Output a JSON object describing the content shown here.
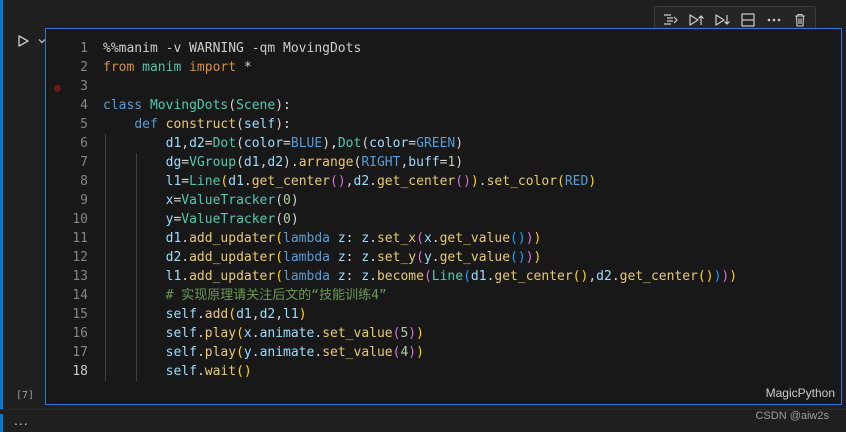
{
  "cell": {
    "execution_count": "[7]",
    "language": "MagicPython",
    "active_line": 18,
    "breakpoint_line": 3,
    "lines": [
      {
        "n": "1",
        "tokens": [
          [
            "mg",
            "%%manim -v WARNING -qm MovingDots"
          ]
        ]
      },
      {
        "n": "2",
        "tokens": [
          [
            "kw",
            "from "
          ],
          [
            "kc",
            "manim "
          ],
          [
            "kw",
            "import "
          ],
          [
            "",
            ""
          ],
          [
            "",
            "*"
          ]
        ]
      },
      {
        "n": "3",
        "tokens": []
      },
      {
        "n": "4",
        "tokens": [
          [
            "kb",
            "class "
          ],
          [
            "cl",
            "MovingDots"
          ],
          [
            "",
            "("
          ],
          [
            "cl",
            "Scene"
          ],
          [
            "",
            "):"
          ]
        ]
      },
      {
        "n": "5",
        "tokens": [
          [
            "",
            "    "
          ],
          [
            "kb",
            "def "
          ],
          [
            "fn",
            "construct"
          ],
          [
            "",
            "("
          ],
          [
            "va",
            "self"
          ],
          [
            "",
            "):"
          ]
        ]
      },
      {
        "n": "6",
        "tokens": [
          [
            "",
            "        "
          ],
          [
            "va",
            "d1"
          ],
          [
            "",
            ","
          ],
          [
            "va",
            "d2"
          ],
          [
            "",
            "="
          ],
          [
            "cl",
            "Dot"
          ],
          [
            "",
            "("
          ],
          [
            "va",
            "color"
          ],
          [
            "",
            "="
          ],
          [
            "kb",
            "BLUE"
          ],
          [
            "",
            "),"
          ],
          [
            "cl",
            "Dot"
          ],
          [
            "",
            "("
          ],
          [
            "va",
            "color"
          ],
          [
            "",
            "="
          ],
          [
            "kb",
            "GREEN"
          ],
          [
            "",
            ")"
          ]
        ]
      },
      {
        "n": "7",
        "tokens": [
          [
            "",
            "        "
          ],
          [
            "va",
            "dg"
          ],
          [
            "",
            "="
          ],
          [
            "cl",
            "VGroup"
          ],
          [
            "",
            "("
          ],
          [
            "va",
            "d1"
          ],
          [
            "",
            ","
          ],
          [
            "va",
            "d2"
          ],
          [
            "",
            ")."
          ],
          [
            "fn",
            "arrange"
          ],
          [
            "",
            "("
          ],
          [
            "kb",
            "RIGHT"
          ],
          [
            "",
            ","
          ],
          [
            "va",
            "buff"
          ],
          [
            "",
            "="
          ],
          [
            "nu",
            "1"
          ],
          [
            "",
            ")"
          ]
        ]
      },
      {
        "n": "8",
        "tokens": [
          [
            "",
            "        "
          ],
          [
            "va",
            "l1"
          ],
          [
            "",
            "="
          ],
          [
            "cl",
            "Line"
          ],
          [
            "p1",
            "("
          ],
          [
            "va",
            "d1"
          ],
          [
            "",
            "."
          ],
          [
            "fn",
            "get_center"
          ],
          [
            "p2",
            "()"
          ],
          [
            "",
            ","
          ],
          [
            "va",
            "d2"
          ],
          [
            "",
            "."
          ],
          [
            "fn",
            "get_center"
          ],
          [
            "p2",
            "()"
          ],
          [
            "p1",
            ")"
          ],
          [
            "",
            "."
          ],
          [
            "fn",
            "set_color"
          ],
          [
            "p1",
            "("
          ],
          [
            "kb",
            "RED"
          ],
          [
            "p1",
            ")"
          ]
        ]
      },
      {
        "n": "9",
        "tokens": [
          [
            "",
            "        "
          ],
          [
            "va",
            "x"
          ],
          [
            "",
            "="
          ],
          [
            "cl",
            "ValueTracker"
          ],
          [
            "",
            "("
          ],
          [
            "nu",
            "0"
          ],
          [
            "",
            ")"
          ]
        ]
      },
      {
        "n": "10",
        "tokens": [
          [
            "",
            "        "
          ],
          [
            "va",
            "y"
          ],
          [
            "",
            "="
          ],
          [
            "cl",
            "ValueTracker"
          ],
          [
            "",
            "("
          ],
          [
            "nu",
            "0"
          ],
          [
            "",
            ")"
          ]
        ]
      },
      {
        "n": "11",
        "tokens": [
          [
            "",
            "        "
          ],
          [
            "va",
            "d1"
          ],
          [
            "",
            "."
          ],
          [
            "fn",
            "add_updater"
          ],
          [
            "p1",
            "("
          ],
          [
            "kb",
            "lambda "
          ],
          [
            "va",
            "z"
          ],
          [
            "",
            ": "
          ],
          [
            "va",
            "z"
          ],
          [
            "",
            "."
          ],
          [
            "fn",
            "set_x"
          ],
          [
            "p2",
            "("
          ],
          [
            "va",
            "x"
          ],
          [
            "",
            "."
          ],
          [
            "fn",
            "get_value"
          ],
          [
            "p3",
            "()"
          ],
          [
            "p2",
            ")"
          ],
          [
            "p1",
            ")"
          ]
        ]
      },
      {
        "n": "12",
        "tokens": [
          [
            "",
            "        "
          ],
          [
            "va",
            "d2"
          ],
          [
            "",
            "."
          ],
          [
            "fn",
            "add_updater"
          ],
          [
            "p1",
            "("
          ],
          [
            "kb",
            "lambda "
          ],
          [
            "va",
            "z"
          ],
          [
            "",
            ": "
          ],
          [
            "va",
            "z"
          ],
          [
            "",
            "."
          ],
          [
            "fn",
            "set_y"
          ],
          [
            "p2",
            "("
          ],
          [
            "va",
            "y"
          ],
          [
            "",
            "."
          ],
          [
            "fn",
            "get_value"
          ],
          [
            "p3",
            "()"
          ],
          [
            "p2",
            ")"
          ],
          [
            "p1",
            ")"
          ]
        ]
      },
      {
        "n": "13",
        "tokens": [
          [
            "",
            "        "
          ],
          [
            "va",
            "l1"
          ],
          [
            "",
            "."
          ],
          [
            "fn",
            "add_updater"
          ],
          [
            "p1",
            "("
          ],
          [
            "kb",
            "lambda "
          ],
          [
            "va",
            "z"
          ],
          [
            "",
            ": "
          ],
          [
            "va",
            "z"
          ],
          [
            "",
            "."
          ],
          [
            "fn",
            "become"
          ],
          [
            "p2",
            "("
          ],
          [
            "cl",
            "Line"
          ],
          [
            "p3",
            "("
          ],
          [
            "va",
            "d1"
          ],
          [
            "",
            "."
          ],
          [
            "fn",
            "get_center"
          ],
          [
            "p1",
            "()"
          ],
          [
            "",
            ","
          ],
          [
            "va",
            "d2"
          ],
          [
            "",
            "."
          ],
          [
            "fn",
            "get_center"
          ],
          [
            "p1",
            "()"
          ],
          [
            "p3",
            ")"
          ],
          [
            "p2",
            ")"
          ],
          [
            "p1",
            ")"
          ]
        ]
      },
      {
        "n": "14",
        "tokens": [
          [
            "",
            "        "
          ],
          [
            "cm",
            "# 实现原理请关注后文的“技能训练4”"
          ]
        ]
      },
      {
        "n": "15",
        "tokens": [
          [
            "",
            "        "
          ],
          [
            "va",
            "self"
          ],
          [
            "",
            "."
          ],
          [
            "fn",
            "add"
          ],
          [
            "p1",
            "("
          ],
          [
            "va",
            "d1"
          ],
          [
            "",
            ","
          ],
          [
            "va",
            "d2"
          ],
          [
            "",
            ","
          ],
          [
            "va",
            "l1"
          ],
          [
            "p1",
            ")"
          ]
        ]
      },
      {
        "n": "16",
        "tokens": [
          [
            "",
            "        "
          ],
          [
            "va",
            "self"
          ],
          [
            "",
            "."
          ],
          [
            "fn",
            "play"
          ],
          [
            "p1",
            "("
          ],
          [
            "va",
            "x"
          ],
          [
            "",
            "."
          ],
          [
            "va",
            "animate"
          ],
          [
            "",
            "."
          ],
          [
            "fn",
            "set_value"
          ],
          [
            "p2",
            "("
          ],
          [
            "nu",
            "5"
          ],
          [
            "p2",
            ")"
          ],
          [
            "p1",
            ")"
          ]
        ]
      },
      {
        "n": "17",
        "tokens": [
          [
            "",
            "        "
          ],
          [
            "va",
            "self"
          ],
          [
            "",
            "."
          ],
          [
            "fn",
            "play"
          ],
          [
            "p1",
            "("
          ],
          [
            "va",
            "y"
          ],
          [
            "",
            "."
          ],
          [
            "va",
            "animate"
          ],
          [
            "",
            "."
          ],
          [
            "fn",
            "set_value"
          ],
          [
            "p2",
            "("
          ],
          [
            "nu",
            "4"
          ],
          [
            "p2",
            ")"
          ],
          [
            "p1",
            ")"
          ]
        ]
      },
      {
        "n": "18",
        "tokens": [
          [
            "",
            "        "
          ],
          [
            "va",
            "self"
          ],
          [
            "",
            "."
          ],
          [
            "fn",
            "wait"
          ],
          [
            "p1",
            "()"
          ]
        ]
      }
    ]
  },
  "toolbar": {
    "icons": [
      "run-by-line-icon",
      "execute-above-icon",
      "execute-below-icon",
      "split-cell-icon",
      "more-icon",
      "delete-icon"
    ]
  },
  "footer": {
    "ellipsis": "...",
    "watermark": "CSDN @aiw2s"
  }
}
